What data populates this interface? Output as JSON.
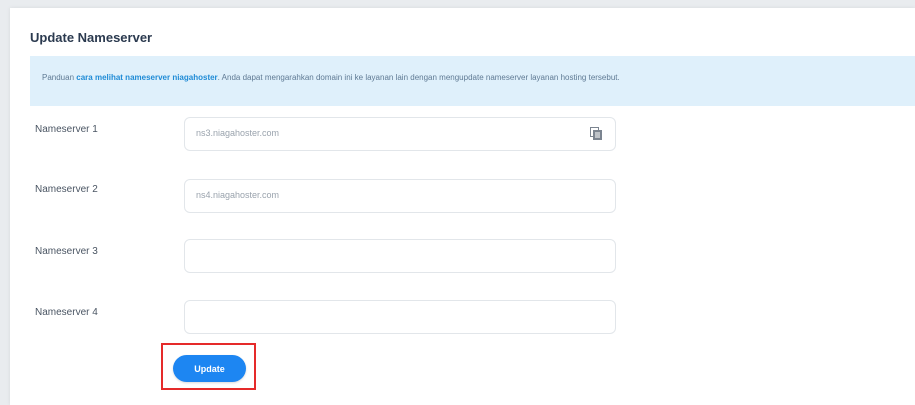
{
  "header": {
    "title": "Update Nameserver"
  },
  "info": {
    "prefix": "Panduan",
    "link": "cara melihat nameserver niagahoster",
    "suffix": ". Anda dapat mengarahkan domain ini ke layanan lain dengan mengupdate nameserver layanan hosting tersebut."
  },
  "nameservers": [
    {
      "label": "Nameserver 1",
      "value": "ns3.niagahoster.com"
    },
    {
      "label": "Nameserver 2",
      "value": "ns4.niagahoster.com"
    },
    {
      "label": "Nameserver 3",
      "value": ""
    },
    {
      "label": "Nameserver 4",
      "value": ""
    }
  ],
  "actions": {
    "update_label": "Update"
  },
  "icons": {
    "copy": "copy-icon"
  },
  "colors": {
    "accent": "#1d86f2",
    "info_bg": "#dff0fb",
    "link": "#1f8bd6",
    "highlight": "#e52a2a"
  }
}
